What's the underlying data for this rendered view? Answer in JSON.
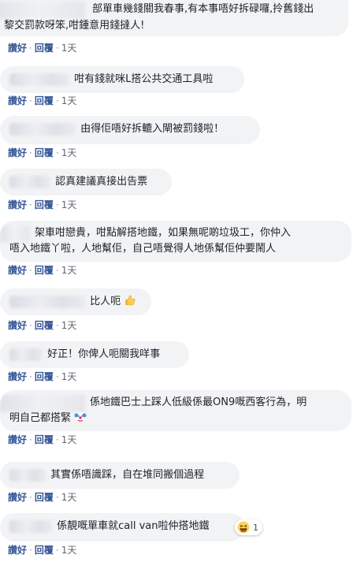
{
  "actions": {
    "like": "讚好",
    "reply": "回覆",
    "separator": "·"
  },
  "comments": [
    {
      "lines": [
        "部單車幾錢關我春事,有本事唔好拆碌囉,拎舊錢出",
        "黎交罰款呀笨,咁鍾意用錢撻人!"
      ],
      "time": "1天"
    },
    {
      "lines": [
        "咁有錢就咪L搭公共交通工具啦"
      ],
      "time": "1天"
    },
    {
      "lines": [
        "由得佢唔好拆轆入閘被罰錢啦！"
      ],
      "time": "1天"
    },
    {
      "lines": [
        "認真建議真接出告票"
      ],
      "time": "1天"
    },
    {
      "lines": [
        "架車咁戀貴，咁點解搭地鐵，如果無呢啲垃圾工，你仲入",
        "唔入地鐵丫啦，人地幫佢，自己唔覺得人地係幫佢仲要鬧人"
      ],
      "time": "1天"
    },
    {
      "lines": [
        "比人呃"
      ],
      "emoji": "thumbs-up-icon",
      "time": "1天"
    },
    {
      "lines": [
        "好正！你俾人呃關我咩事"
      ],
      "time": "1天"
    },
    {
      "lines": [
        "係地鐵巴士上踩人低級係最ON9嘅西客行為，明",
        "明自己都搭緊"
      ],
      "emoji": "clown-face-icon",
      "time": "1天"
    },
    {
      "lines": [
        "其實係唔識踩，自在堆同搬個過程"
      ],
      "time": "1天"
    },
    {
      "lines": [
        "係靚嘅單車就call van啦仲搭地鐵"
      ],
      "reaction": {
        "icon": "haha-reaction-icon",
        "count": "1"
      },
      "time": "1天"
    }
  ]
}
